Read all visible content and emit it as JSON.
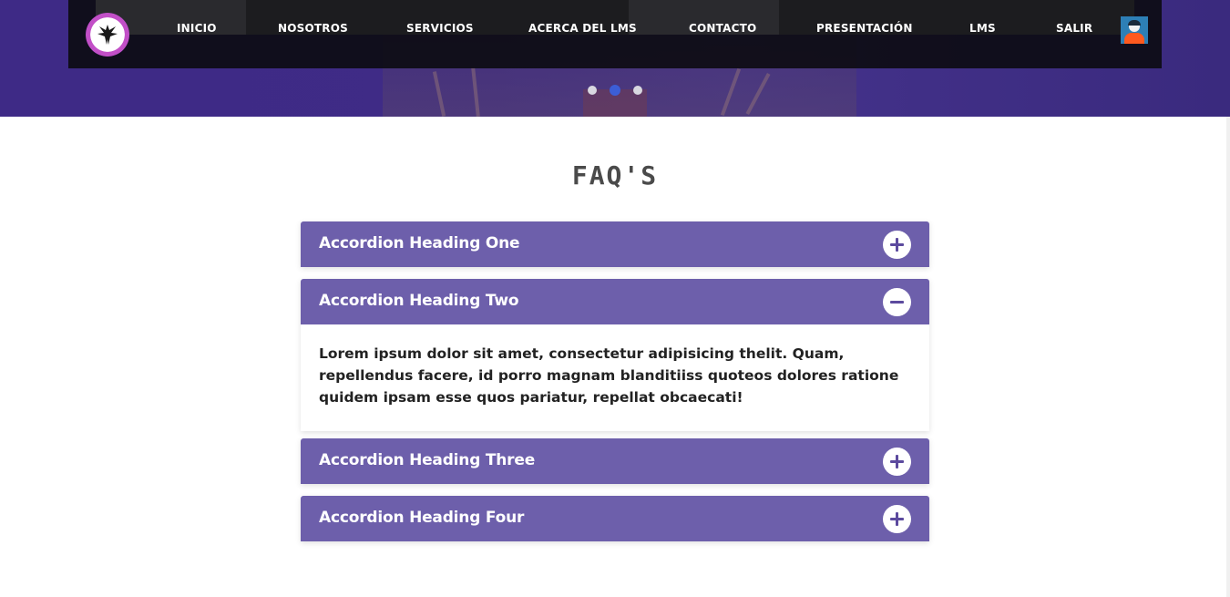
{
  "nav": {
    "items": [
      {
        "label": "INICIO"
      },
      {
        "label": "NOSOTROS"
      },
      {
        "label": "SERVICIOS"
      },
      {
        "label": "ACERCA DEL LMS"
      },
      {
        "label": "CONTACTO"
      },
      {
        "label": "PRESENTACIÓN"
      },
      {
        "label": "LMS"
      },
      {
        "label": "SALIR"
      }
    ]
  },
  "carousel": {
    "slide_count": 3,
    "active_index": 1
  },
  "faq": {
    "title": "FAQ'S",
    "items": [
      {
        "heading": "Accordion Heading One",
        "expanded": false,
        "icon": "plus-icon"
      },
      {
        "heading": "Accordion Heading Two",
        "expanded": true,
        "icon": "minus-icon",
        "body": "Lorem ipsum dolor sit amet, consectetur adipisicing thelit. Quam, repellendus facere, id porro magnam blanditiiss quoteos dolores ratione quidem ipsam esse quos pariatur, repellat obcaecati!"
      },
      {
        "heading": "Accordion Heading Three",
        "expanded": false,
        "icon": "plus-icon"
      },
      {
        "heading": "Accordion Heading Four",
        "expanded": false,
        "icon": "plus-icon"
      }
    ]
  },
  "colors": {
    "header_bg": "#3e2a86",
    "accordion_header": "#6d5fab",
    "active_dot": "#3c5ed6",
    "title_text": "#4a4a4a"
  }
}
